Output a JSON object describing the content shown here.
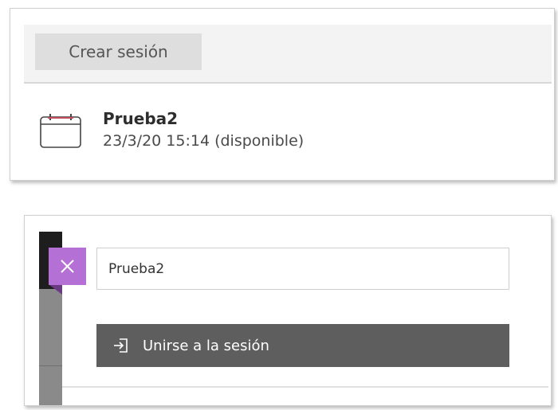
{
  "top_panel": {
    "create_button_label": "Crear sesión",
    "session": {
      "icon": "calendar-icon",
      "title": "Prueba2",
      "meta": "23/3/20 15:14 (disponible)"
    }
  },
  "bottom_panel": {
    "close_icon": "close-icon",
    "session_name_value": "Prueba2",
    "join_button": {
      "icon": "sign-in-icon",
      "label": "Unirse a la sesión"
    }
  },
  "colors": {
    "accent_purple": "#b570d6",
    "join_button_bg": "#5e5e5e",
    "create_button_bg": "#dedede"
  }
}
